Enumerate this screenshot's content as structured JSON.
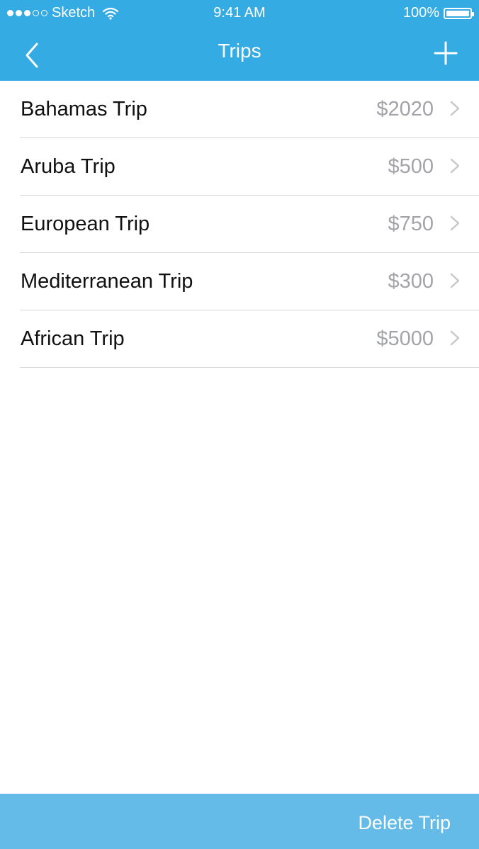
{
  "status_bar": {
    "carrier": "Sketch",
    "time": "9:41 AM",
    "battery": "100%",
    "signal_dots_filled": 3,
    "signal_dots_total": 5
  },
  "nav": {
    "title": "Trips",
    "back_icon": "chevron-left-icon",
    "add_icon": "plus-icon"
  },
  "trips": [
    {
      "name": "Bahamas Trip",
      "price": "$2020"
    },
    {
      "name": "Aruba Trip",
      "price": "$500"
    },
    {
      "name": "European Trip",
      "price": "$750"
    },
    {
      "name": "Mediterranean Trip",
      "price": "$300"
    },
    {
      "name": "African Trip",
      "price": "$5000"
    }
  ],
  "footer": {
    "delete_label": "Delete Trip"
  },
  "colors": {
    "header": "#34ace3",
    "footer": "#64bbe8",
    "price": "#a3a4a8",
    "chevron": "#c7c7cc"
  }
}
